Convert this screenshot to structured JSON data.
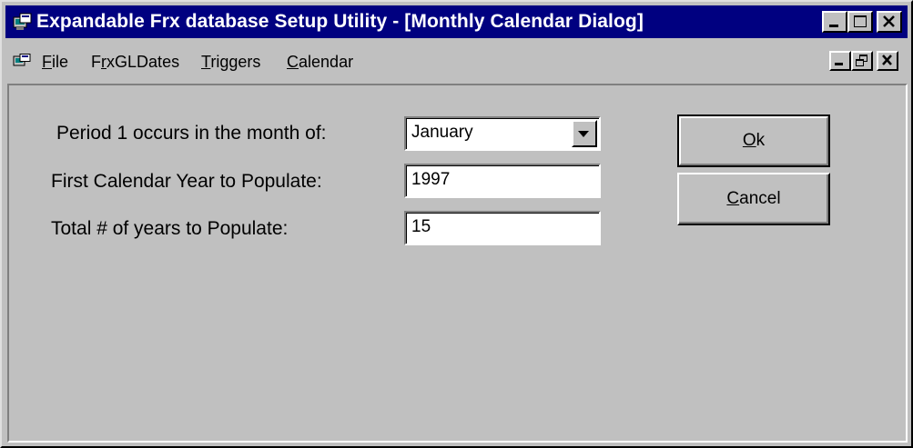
{
  "window": {
    "title": "Expandable Frx database Setup Utility - [Monthly Calendar Dialog]"
  },
  "menu": {
    "items": [
      {
        "label": "File",
        "accel_index": 0
      },
      {
        "label": "FrxGLDates",
        "accel_index": 1
      },
      {
        "label": "Triggers",
        "accel_index": 0
      },
      {
        "label": "Calendar",
        "accel_index": 0
      }
    ]
  },
  "form": {
    "period_label": "Period 1 occurs in the month of:",
    "period_value": "January",
    "first_year_label": "First Calendar Year to Populate:",
    "first_year_value": "1997",
    "total_years_label": "Total # of years to Populate:",
    "total_years_value": "15"
  },
  "buttons": {
    "ok": {
      "label": "Ok",
      "accel_index": 0
    },
    "cancel": {
      "label": "Cancel",
      "accel_index": 0
    }
  },
  "icons": {
    "app": "setup-app-icon",
    "doc": "mdi-document-icon",
    "minimize": "minimize-icon",
    "maximize": "maximize-icon",
    "close": "close-icon",
    "restore": "restore-icon",
    "dropdown": "dropdown-arrow-icon"
  },
  "colors": {
    "titlebar": "#000080",
    "face": "#c0c0c0"
  }
}
